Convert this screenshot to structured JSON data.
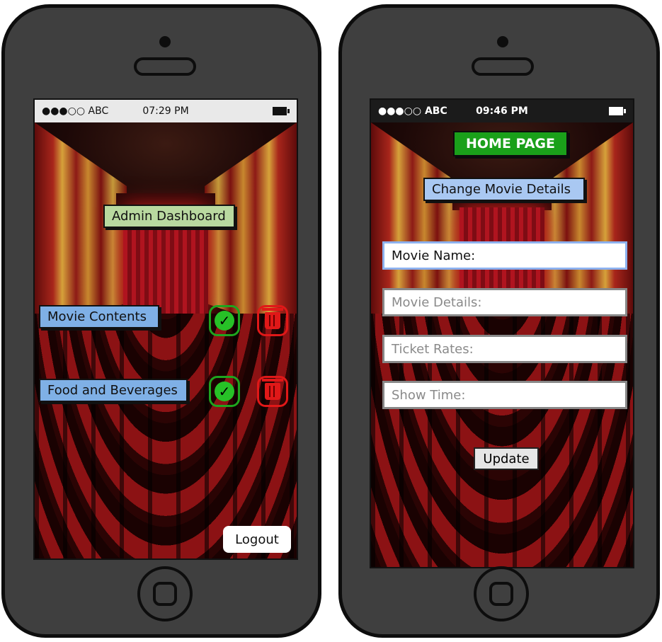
{
  "left_screen": {
    "status": {
      "carrier": "●●●○○ ABC",
      "time": "07:29 PM"
    },
    "title": "Admin Dashboard",
    "rows": [
      {
        "label": "Movie Contents",
        "approve_icon": "check-circle-icon",
        "delete_icon": "trash-icon"
      },
      {
        "label": "Food and Beverages",
        "approve_icon": "check-circle-icon",
        "delete_icon": "trash-icon"
      }
    ],
    "logout_label": "Logout"
  },
  "right_screen": {
    "status": {
      "carrier": "●●●○○ ABC",
      "time": "09:46 PM"
    },
    "home_button": "HOME PAGE",
    "title": "Change Movie Details",
    "fields": [
      {
        "label": "Movie Name:",
        "active": true
      },
      {
        "label": "Movie Details:"
      },
      {
        "label": "Ticket Rates:"
      },
      {
        "label": "Show Time:"
      }
    ],
    "update_label": "Update"
  },
  "colors": {
    "label_green": "#b9d9a0",
    "label_blue": "#7fb0e6",
    "home_green": "#1aa01a",
    "check_green": "#27c127",
    "trash_red": "#e01818"
  }
}
